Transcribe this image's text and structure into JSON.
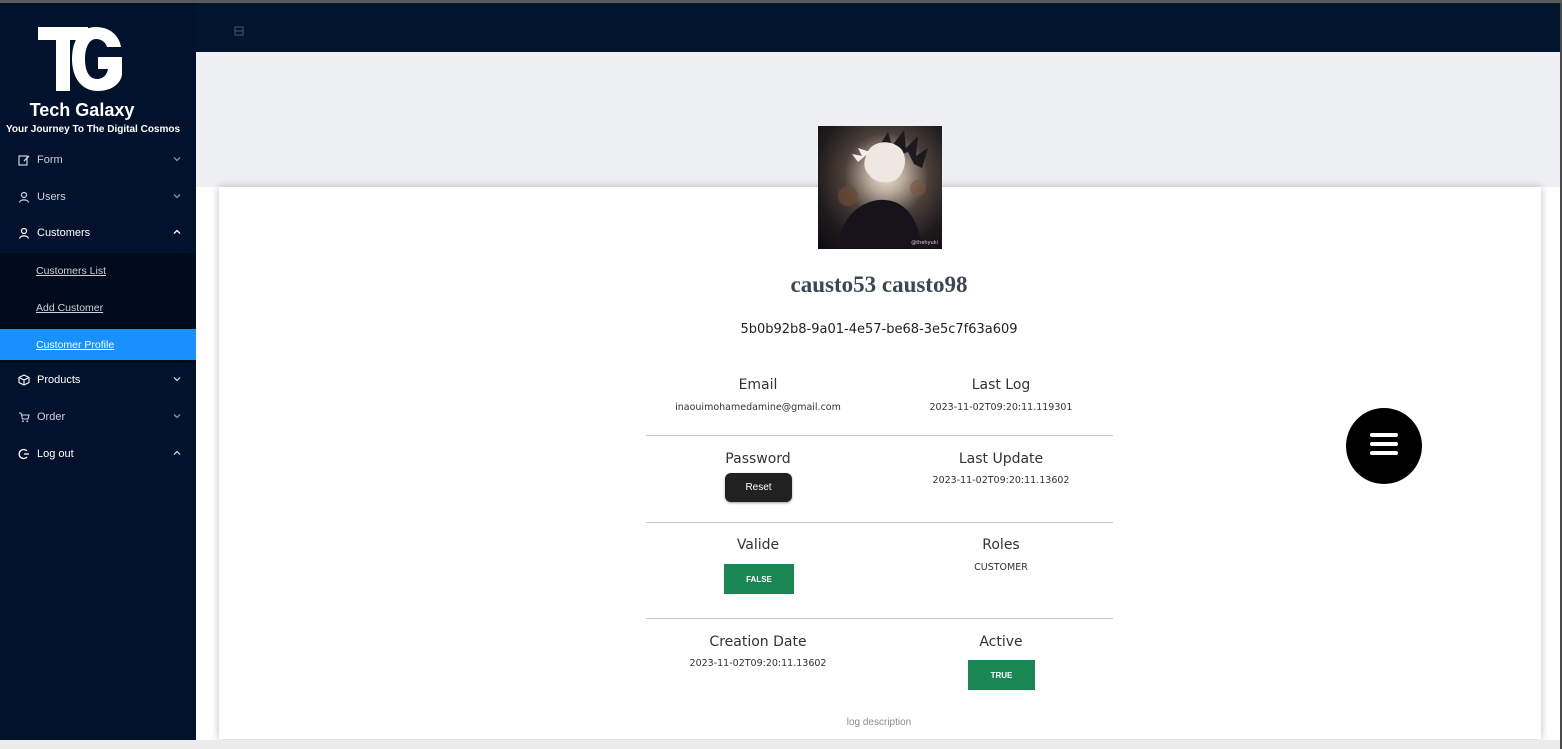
{
  "brand": {
    "logo_text": "TG",
    "title": "Tech Galaxy",
    "subtitle": "Your Journey To The Digital Cosmos"
  },
  "sidebar": {
    "items": [
      {
        "label": "Form",
        "icon": "edit-icon"
      },
      {
        "label": "Users",
        "icon": "user-icon"
      },
      {
        "label": "Customers",
        "icon": "user-icon",
        "expanded": true
      },
      {
        "label": "Products",
        "icon": "cube-icon"
      },
      {
        "label": "Order",
        "icon": "cart-icon"
      },
      {
        "label": "Log out",
        "icon": "logout-icon"
      }
    ],
    "customers_sub": [
      {
        "label": "Customers List"
      },
      {
        "label": "Add Customer"
      },
      {
        "label": "Customer Profile",
        "active": true
      }
    ]
  },
  "profile": {
    "avatar_watermark": "@thehyuki",
    "name": "causto53 causto98",
    "id": "5b0b92b8-9a01-4e57-be68-3e5c7f63a609",
    "email_label": "Email",
    "email": "inaouimohamedamine@gmail.com",
    "last_log_label": "Last Log",
    "last_log": "2023-11-02T09:20:11.119301",
    "password_label": "Password",
    "reset_label": "Reset",
    "last_update_label": "Last Update",
    "last_update": "2023-11-02T09:20:11.13602",
    "valide_label": "Valide",
    "valide": "FALSE",
    "roles_label": "Roles",
    "roles": "CUSTOMER",
    "creation_label": "Creation Date",
    "creation": "2023-11-02T09:20:11.13602",
    "active_label": "Active",
    "active": "TRUE",
    "log_description": "log description"
  },
  "colors": {
    "sidebar_bg": "#02122c",
    "active_item": "#1890ff",
    "badge_green": "#198754",
    "reset_btn": "#212121"
  }
}
